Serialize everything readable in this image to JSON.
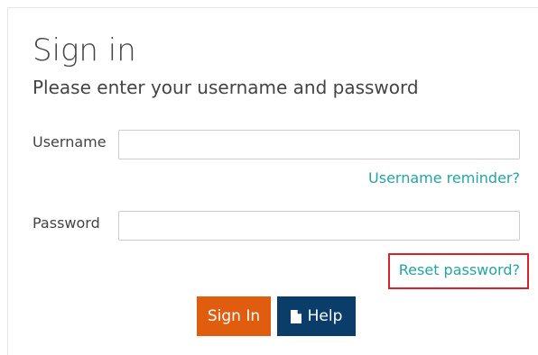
{
  "signin": {
    "title": "Sign in",
    "subtitle": "Please enter your username and password",
    "username_label": "Username",
    "username_value": "",
    "password_label": "Password",
    "password_value": "",
    "username_reminder_link": "Username reminder?",
    "reset_password_link": "Reset password?",
    "signin_button": "Sign In",
    "help_button": "Help",
    "help_icon": "document-icon"
  },
  "colors": {
    "link": "#24a4a4",
    "signin_button": "#e05d0f",
    "help_button": "#0b3d6b",
    "highlight": "#d9222a",
    "text": "#444444"
  }
}
